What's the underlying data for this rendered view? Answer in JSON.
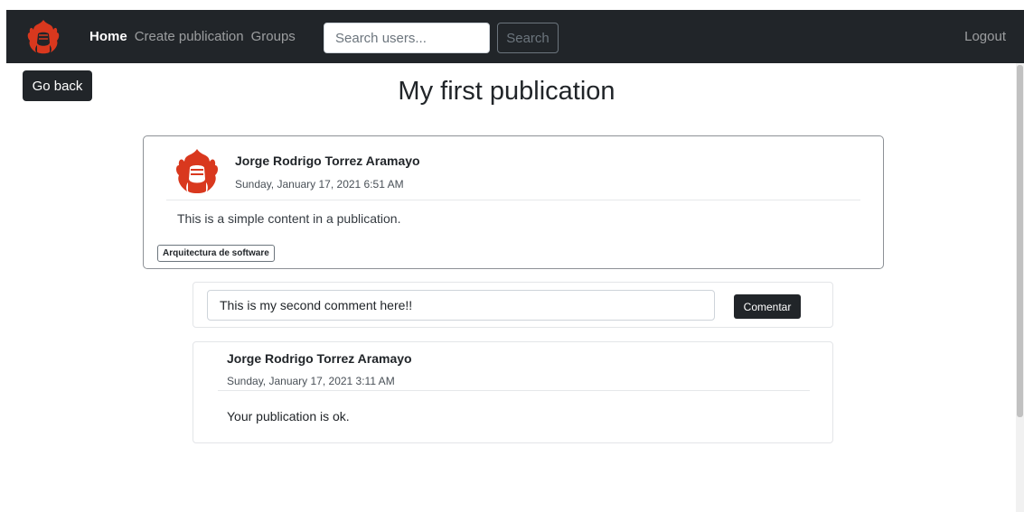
{
  "navbar": {
    "logo_icon": "flaming-fist-icon",
    "links": [
      {
        "label": "Home",
        "active": true
      },
      {
        "label": "Create publication",
        "active": false
      },
      {
        "label": "Groups",
        "active": false
      }
    ],
    "search": {
      "placeholder": "Search users...",
      "button_label": "Search"
    },
    "logout_label": "Logout"
  },
  "page": {
    "go_back_label": "Go back",
    "title": "My first publication"
  },
  "publication": {
    "author": "Jorge Rodrigo Torrez Aramayo",
    "date": "Sunday, January 17, 2021 6:51 AM",
    "content": "This is a simple content in a publication.",
    "tag": "Arquitectura de software"
  },
  "comment_form": {
    "value": "This is my second comment here!!",
    "button_label": "Comentar"
  },
  "comments": [
    {
      "author": "Jorge Rodrigo Torrez Aramayo",
      "date": "Sunday, January 17, 2021 3:11 AM",
      "text": "Your publication is ok."
    }
  ],
  "colors": {
    "navbar_bg": "#212529",
    "logo_red": "#d9381e",
    "button_dark": "#212529"
  }
}
